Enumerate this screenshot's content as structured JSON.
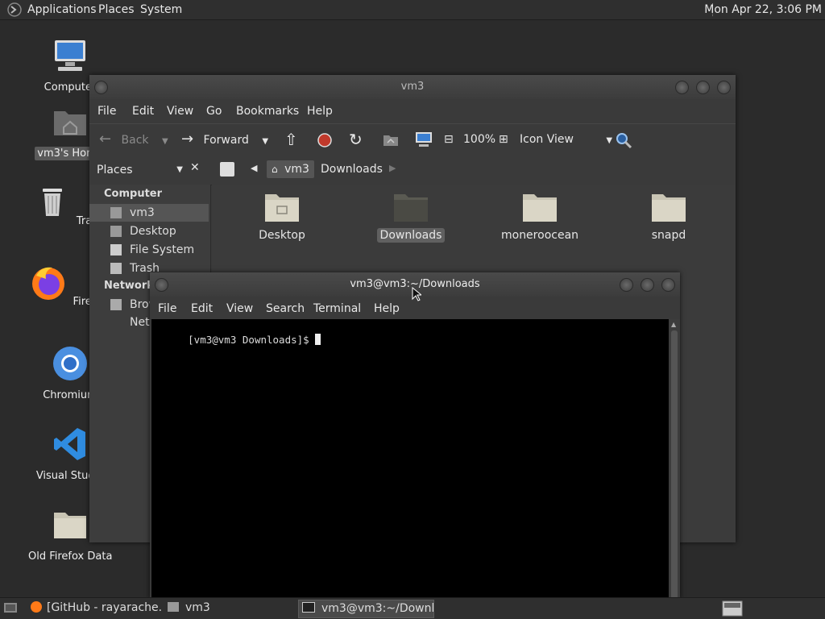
{
  "top_panel": {
    "menus": [
      "Applications",
      "Places",
      "System"
    ],
    "clock": "Mon Apr 22,  3:06 PM"
  },
  "desktop_icons": [
    {
      "name": "computer",
      "label": "Computer"
    },
    {
      "name": "home",
      "label": "vm3's Home"
    },
    {
      "name": "trash",
      "label": "Trash"
    },
    {
      "name": "firefox",
      "label": "Firefox"
    },
    {
      "name": "chromium",
      "label": "Chromium"
    },
    {
      "name": "vscode",
      "label": "Visual Studio"
    },
    {
      "name": "folder",
      "label": "Old Firefox Data"
    }
  ],
  "file_manager": {
    "title": "vm3",
    "menus": [
      "File",
      "Edit",
      "View",
      "Go",
      "Bookmarks",
      "Help"
    ],
    "toolbar": {
      "back": "Back",
      "forward": "Forward",
      "zoom": "100%",
      "view_mode": "Icon View"
    },
    "side_pane_selector": "Places",
    "breadcrumb": [
      "vm3",
      "Downloads"
    ],
    "sidebar": {
      "computer_header": "Computer",
      "items": [
        "vm3",
        "Desktop",
        "File System",
        "Trash"
      ],
      "network_header": "Network",
      "network_items": [
        "Browse Network"
      ]
    },
    "files": [
      "Desktop",
      "Downloads",
      "moneroocean",
      "snapd"
    ]
  },
  "terminal": {
    "title": "vm3@vm3:~/Downloads",
    "menus": [
      "File",
      "Edit",
      "View",
      "Search",
      "Terminal",
      "Help"
    ],
    "prompt": "[vm3@vm3 Downloads]$ "
  },
  "taskbar": {
    "tasks": [
      "[GitHub - rayarache...",
      "vm3",
      "vm3@vm3:~/Downl..."
    ]
  },
  "colors": {
    "folder": "#c9c5b4",
    "record": "#c0392b",
    "accent": "#4a90d9"
  }
}
